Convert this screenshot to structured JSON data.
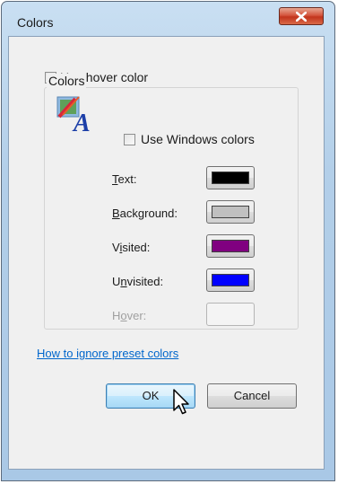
{
  "window": {
    "title": "Colors"
  },
  "hover_checkbox": {
    "label": "Use hover color",
    "checked": false
  },
  "colors_group": {
    "title": "Colors",
    "windows_checkbox": {
      "label": "Use Windows colors",
      "checked": false
    },
    "rows": [
      {
        "label": "Text:",
        "mnemonic_index": 0,
        "color": "#000000",
        "enabled": true
      },
      {
        "label": "Background:",
        "mnemonic_index": 0,
        "color": "#c0c0c0",
        "enabled": true
      },
      {
        "label": "Visited:",
        "mnemonic_index": 1,
        "color": "#800080",
        "enabled": true
      },
      {
        "label": "Unvisited:",
        "mnemonic_index": 1,
        "color": "#0000ff",
        "enabled": true
      },
      {
        "label": "Hover:",
        "mnemonic_index": 1,
        "color": "",
        "enabled": false
      }
    ]
  },
  "help_link": "How to ignore preset colors",
  "buttons": {
    "ok": "OK",
    "cancel": "Cancel"
  },
  "icons": {
    "close": "close-icon",
    "colors": "colors-palette-icon",
    "cursor": "mouse-pointer-icon"
  }
}
